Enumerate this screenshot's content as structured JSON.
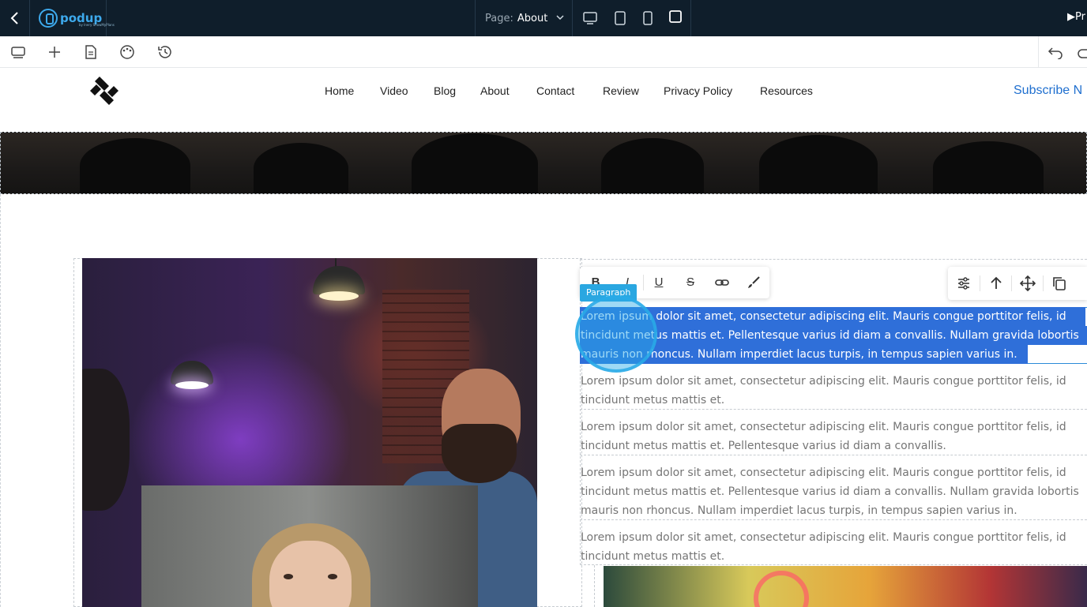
{
  "topbar": {
    "logo_text": "podup",
    "logo_sub": "by Inery ShowMyPlans",
    "page_label": "Page:",
    "page_value": "About",
    "preview_label": "Pr"
  },
  "nav": {
    "items": [
      "Home",
      "Video",
      "Blog",
      "About",
      "Contact",
      "Review",
      "Privacy Policy",
      "Resources"
    ],
    "subscribe": "Subscribe N"
  },
  "editor": {
    "block_tag": "Paragraph",
    "format_buttons": {
      "bold": "B",
      "italic": "I",
      "underline": "U",
      "strike": "S"
    }
  },
  "paragraphs": {
    "p1": [
      "Lorem ipsum dolor sit amet, consectetur adipiscing elit. Mauris congue porttitor felis, id",
      "tincidunt metus mattis et. Pellentesque varius id diam a convallis. Nullam gravida lobortis",
      "mauris non rhoncus. Nullam imperdiet lacus turpis, in tempus sapien varius in."
    ],
    "p2": [
      "Lorem ipsum dolor sit amet, consectetur adipiscing elit. Mauris congue porttitor felis, id",
      "tincidunt metus mattis et."
    ],
    "p3": [
      "Lorem ipsum dolor sit amet, consectetur adipiscing elit. Mauris congue porttitor felis, id",
      "tincidunt metus mattis et. Pellentesque varius id diam a convallis."
    ],
    "p4": [
      "Lorem ipsum dolor sit amet, consectetur adipiscing elit. Mauris congue porttitor felis, id",
      "tincidunt metus mattis et. Pellentesque varius id diam a convallis. Nullam gravida lobortis",
      "mauris non rhoncus. Nullam imperdiet lacus turpis, in tempus sapien varius in."
    ],
    "p5": [
      "Lorem ipsum dolor sit amet, consectetur adipiscing elit. Mauris congue porttitor felis, id",
      "tincidunt metus mattis et."
    ]
  },
  "colors": {
    "topbar_bg": "#0f1e2b",
    "accent": "#2aa7e1",
    "selection": "#2f6fd9",
    "link": "#1f6fcf"
  },
  "icons": [
    "back-icon",
    "layers-icon",
    "plus-icon",
    "page-icon",
    "palette-icon",
    "history-icon",
    "undo-icon",
    "redo-icon",
    "desktop-icon",
    "tablet-icon",
    "mobile-icon",
    "square-icon",
    "link-icon",
    "brush-icon",
    "sliders-icon",
    "arrow-up-icon",
    "move-icon",
    "copy-icon"
  ]
}
